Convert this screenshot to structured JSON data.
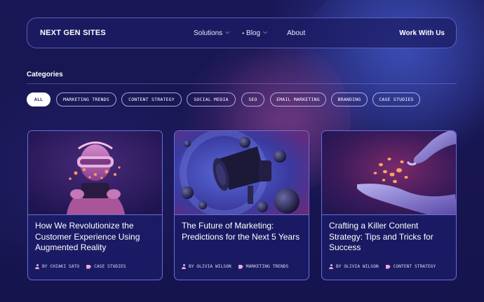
{
  "header": {
    "brand": "NEXT GEN SITES",
    "nav": [
      {
        "label": "Solutions",
        "has_dropdown": true
      },
      {
        "label": "Blog",
        "has_dropdown": true,
        "marker": "•"
      },
      {
        "label": "About",
        "has_dropdown": false
      }
    ],
    "cta": "Work With Us"
  },
  "categories": {
    "title": "Categories",
    "chips": [
      {
        "label": "ALL",
        "active": true
      },
      {
        "label": "MARKETING TRENDS",
        "active": false
      },
      {
        "label": "CONTENT STRATEGY",
        "active": false
      },
      {
        "label": "SOCIAL MEDIA",
        "active": false
      },
      {
        "label": "SEO",
        "active": false
      },
      {
        "label": "EMAIL MARKETING",
        "active": false
      },
      {
        "label": "BRANDING",
        "active": false
      },
      {
        "label": "CASE STUDIES",
        "active": false
      }
    ]
  },
  "posts": [
    {
      "title": "How We Revolutionize the Customer Experience Using Augmented Reality",
      "author": "BY CHIAKI SATO",
      "category": "CASE STUDIES",
      "image": "vr-headset-illustration"
    },
    {
      "title": "The Future of Marketing: Predictions for the Next 5 Years",
      "author": "BY OLIVIA WILSON",
      "category": "MARKETING TRENDS",
      "image": "megaphone-illustration"
    },
    {
      "title": "Crafting a Killer Content Strategy: Tips and Tricks for Success",
      "author": "BY OLIVIA WILSON",
      "category": "CONTENT STRATEGY",
      "image": "hands-coins-illustration"
    }
  ],
  "colors": {
    "background": "#171552",
    "card_border": "#8a8cff",
    "accent_pink": "#f0a8dc",
    "chip_active_bg": "#ffffff"
  },
  "icons": {
    "author": "user-icon",
    "category": "tag-icon",
    "dropdown": "chevron-down-icon"
  }
}
